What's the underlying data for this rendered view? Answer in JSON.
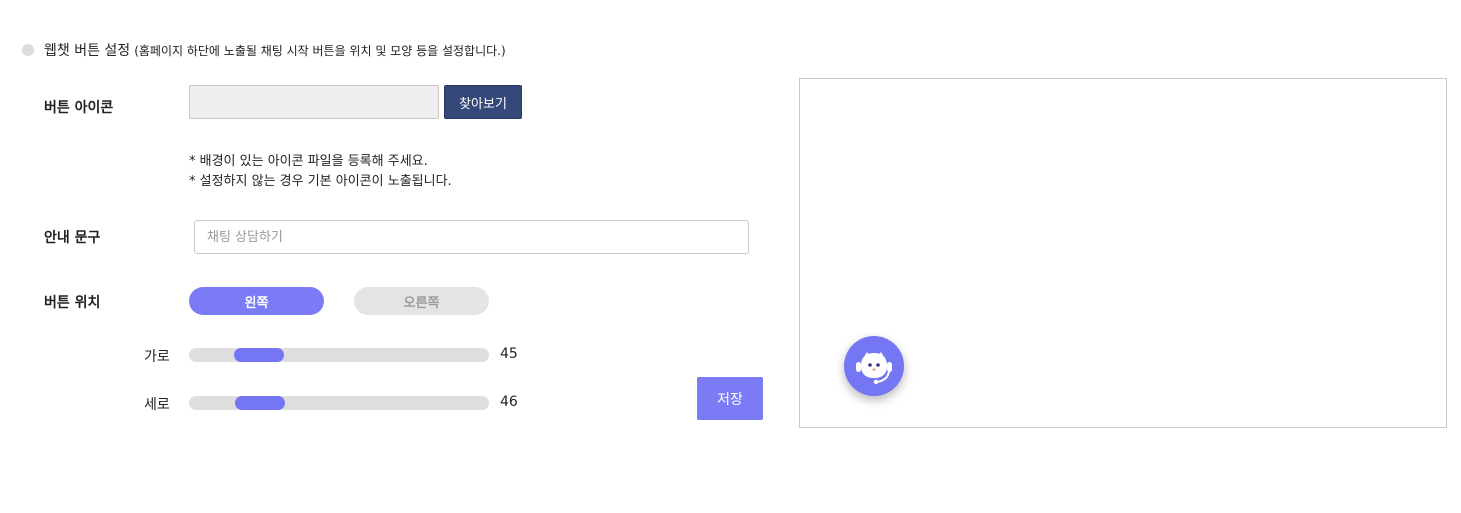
{
  "section": {
    "title": "웹챗 버튼 설정",
    "subtitle": "(홈페이지 하단에 노출될 채팅 시작 버튼을 위치 및 모양 등을 설정합니다.)"
  },
  "button_icon": {
    "label": "버튼 아이콘",
    "file_value": "",
    "browse_label": "찾아보기",
    "notes": [
      "* 배경이 있는 아이콘 파일을 등록해 주세요.",
      "* 설정하지 않는 경우 기본 아이콘이 노출됩니다."
    ]
  },
  "guide_text": {
    "label": "안내 문구",
    "value": "",
    "placeholder": "채팅 상담하기"
  },
  "button_position": {
    "label": "버튼 위치",
    "left_label": "왼쪽",
    "right_label": "오른쪽",
    "selected": "왼쪽"
  },
  "sliders": {
    "horizontal": {
      "label": "가로",
      "value": "45"
    },
    "vertical": {
      "label": "세로",
      "value": "46"
    }
  },
  "save_label": "저장",
  "preview": {
    "icon": "chatbot-headset-icon"
  },
  "colors": {
    "accent": "#7B7CF5",
    "browse_button": "#34497A",
    "inactive_button": "#E4E4E4",
    "slider_track": "#DEDEDE"
  }
}
